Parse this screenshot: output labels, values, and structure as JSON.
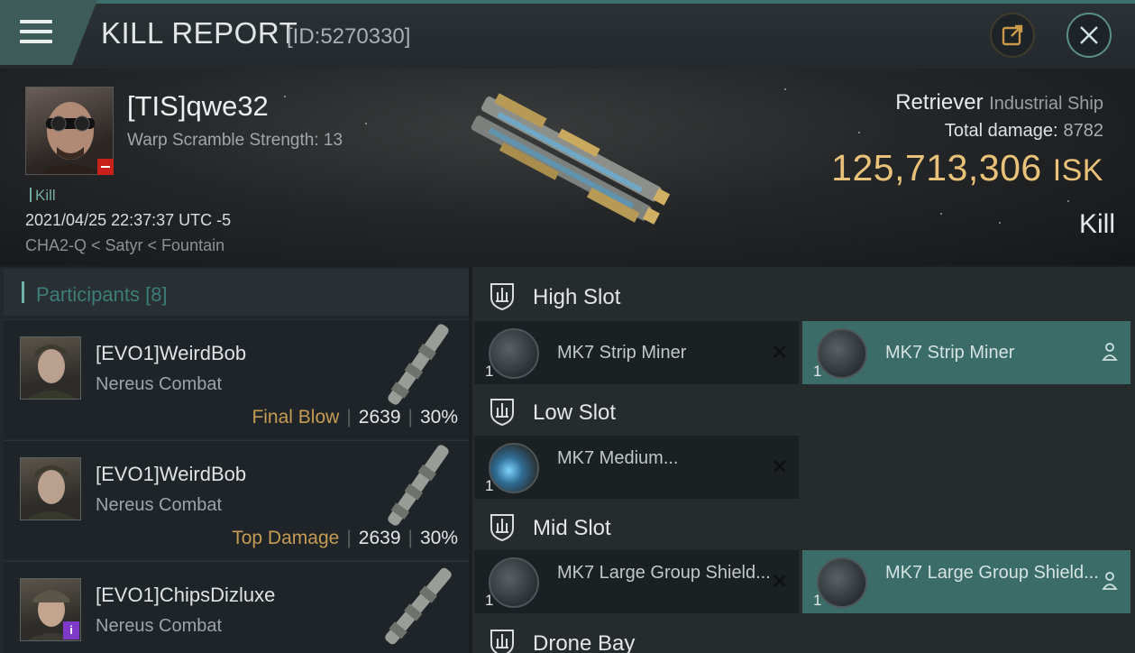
{
  "header": {
    "title": "KILL REPORT",
    "report_id": "[ID:5270330]",
    "icons": {
      "menu": "menu-icon",
      "share": "share-icon",
      "close": "close-icon"
    }
  },
  "victim": {
    "name": "[TIS]qwe32",
    "warp_scramble": "Warp Scramble Strength: 13",
    "kill_tag": "Kill",
    "timestamp": "2021/04/25 22:37:37 UTC -5",
    "location": "CHA2-Q < Satyr < Fountain",
    "ship_name": "Retriever",
    "ship_class": "Industrial Ship",
    "total_damage_label": "Total damage:",
    "total_damage_value": "8782",
    "isk_value": "125,713,306",
    "isk_unit": "ISK",
    "result": "Kill"
  },
  "participants": {
    "label": "Participants",
    "count": "[8]",
    "rows": [
      {
        "name": "[EVO1]WeirdBob",
        "ship": "Nereus Combat",
        "tag": "Final Blow",
        "damage": "2639",
        "percent": "30%"
      },
      {
        "name": "[EVO1]WeirdBob",
        "ship": "Nereus Combat",
        "tag": "Top Damage",
        "damage": "2639",
        "percent": "30%"
      },
      {
        "name": "[EVO1]ChipsDizluxe",
        "ship": "Nereus Combat"
      }
    ]
  },
  "fitting": {
    "high_slot": "High Slot",
    "low_slot": "Low Slot",
    "mid_slot": "Mid Slot",
    "drone_bay": "Drone Bay",
    "high": [
      {
        "name": "MK7 Strip Miner",
        "qty": "1",
        "state": "destroyed"
      },
      {
        "name": "MK7 Strip Miner",
        "qty": "1",
        "state": "dropped"
      }
    ],
    "low": [
      {
        "name": "MK7 Medium...",
        "qty": "1",
        "state": "destroyed"
      }
    ],
    "mid": [
      {
        "name": "MK7 Large Group Shield...",
        "qty": "1",
        "state": "destroyed"
      },
      {
        "name": "MK7 Large Group Shield...",
        "qty": "1",
        "state": "dropped"
      }
    ]
  },
  "colors": {
    "accent_teal": "#3b6c68",
    "isk_gold": "#e9c27a",
    "tag_gold": "#c69c55",
    "danger_red": "#c8201b"
  }
}
